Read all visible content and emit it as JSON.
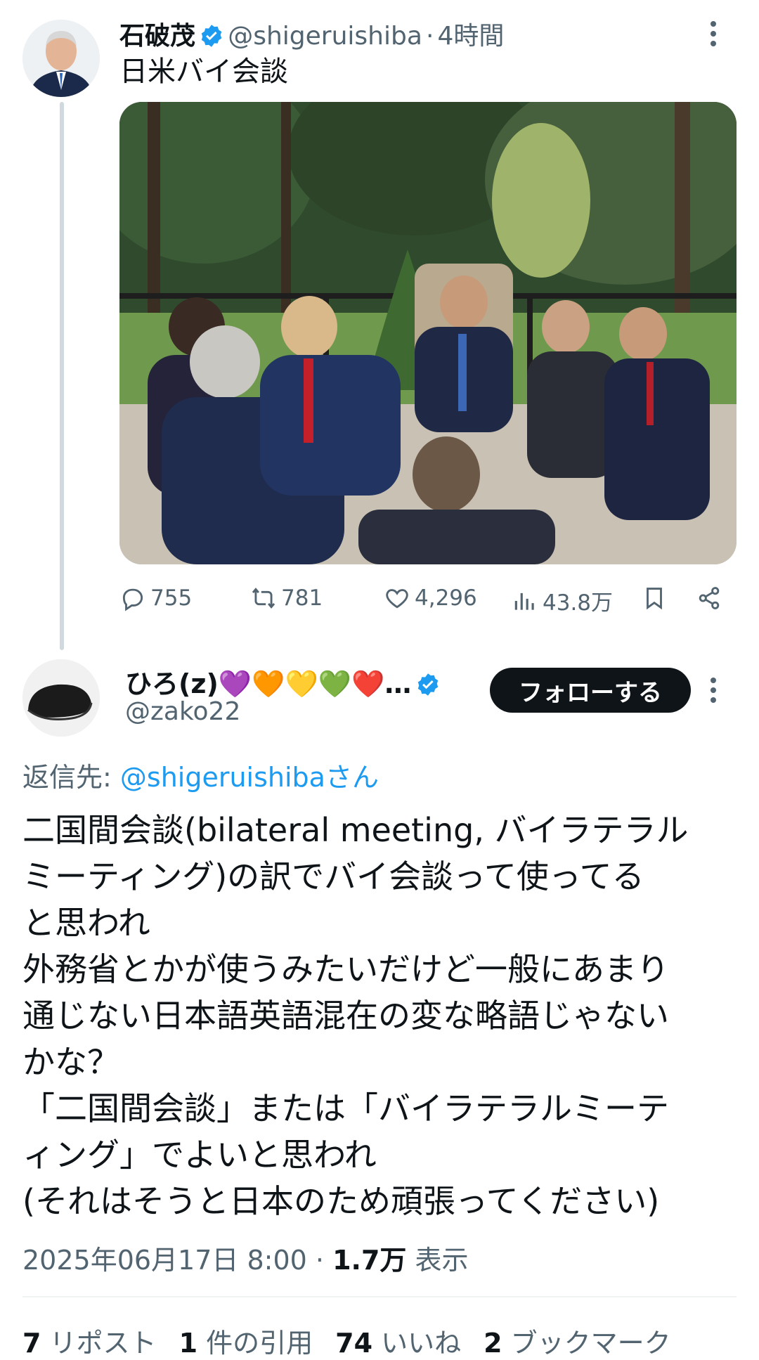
{
  "original_tweet": {
    "author_name": "石破茂",
    "author_handle": "@shigeruishiba",
    "separator": "·",
    "time": "4時間",
    "text": "日米バイ会談",
    "actions": {
      "replies": "755",
      "reposts": "781",
      "likes": "4,296",
      "views": "43.8万"
    }
  },
  "reply": {
    "author_name": "ひろ(z)💜🧡💛💚❤️…",
    "author_handle": "@zako22",
    "follow_label": "フォローする",
    "reply_to_prefix": "返信先: ",
    "reply_to_handle": "@shigeruishibaさん",
    "body": "二国間会談(bilateral meeting, バイラテラル\nミーティング)の訳でバイ会談って使ってる\nと思われ\n外務省とかが使うみたいだけど一般にあまり\n通じない日本語英語混在の変な略語じゃない\nかな？\n「二国間会談」または「バイラテラルミーテ\nィング」でよいと思われ\n(それはそうと日本のため頑張ってください)",
    "timestamp": "2025年06月17日 8:00",
    "dot": "·",
    "views_count": "1.7万",
    "views_label": "表示",
    "stats": [
      {
        "count": "7",
        "label": "リポスト"
      },
      {
        "count": "1",
        "label": "件の引用"
      },
      {
        "count": "74",
        "label": "いいね"
      },
      {
        "count": "2",
        "label": "ブックマーク"
      }
    ]
  },
  "colors": {
    "verified": "#1d9bf0",
    "link": "#1d9bf0",
    "muted": "#536471",
    "follow_bg": "#0f1419"
  }
}
